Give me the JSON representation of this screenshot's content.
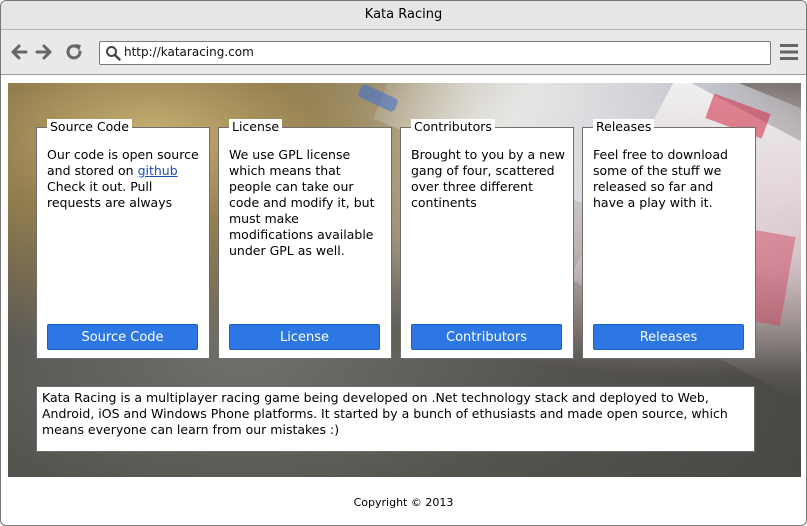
{
  "window": {
    "title": "Kata Racing"
  },
  "toolbar": {
    "url": "http://kataracing.com",
    "back_icon": "arrow-left",
    "forward_icon": "arrow-right",
    "reload_icon": "reload",
    "search_icon": "magnifier",
    "menu_icon": "hamburger"
  },
  "cards": [
    {
      "legend": "Source Code",
      "text_before_link": "Our code is open source and stored on ",
      "link": "github",
      "text_after_link": " Check it out. Pull requests are always",
      "button": "Source Code"
    },
    {
      "legend": "License",
      "text": "We use GPL license which means that people can take our code and modify it, but must make modifications available under GPL as well.",
      "button": "License"
    },
    {
      "legend": "Contributors",
      "text": "Brought to you by a new gang of four, scattered over three different continents",
      "button": "Contributors"
    },
    {
      "legend": "Releases",
      "text": "Feel free to download some of the stuff we released so far and have a play with it.",
      "button": "Releases"
    }
  ],
  "about": {
    "text": "Kata Racing is a multiplayer racing game being developed on .Net technology stack and deployed to Web, Android, iOS and Windows Phone platforms. It started by a bunch of ethusiasts and made open source, which means everyone can learn from our mistakes :)"
  },
  "footer": {
    "copyright": "Copyright © 2013"
  },
  "colors": {
    "button_bg": "#2d77e4",
    "link": "#1a4fb8",
    "titlebar_bg": "#e6e6e6"
  }
}
